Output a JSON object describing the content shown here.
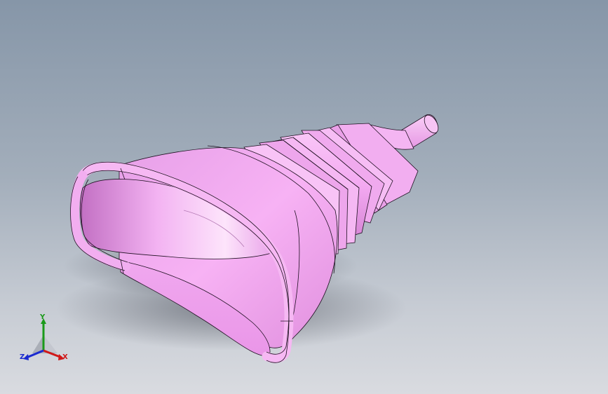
{
  "viewport": {
    "background_top": "#8696a8",
    "background_bottom": "#d9dbe0",
    "model_color": "#f2a6f0",
    "edge_color": "#1e1020"
  },
  "model": {
    "icon": "funnel-boot-3d-model"
  },
  "triad": {
    "x_label": "X",
    "y_label": "Y",
    "z_label": "Z",
    "x_color": "#d01818",
    "y_color": "#1a9a1a",
    "z_color": "#1a2ad0"
  }
}
